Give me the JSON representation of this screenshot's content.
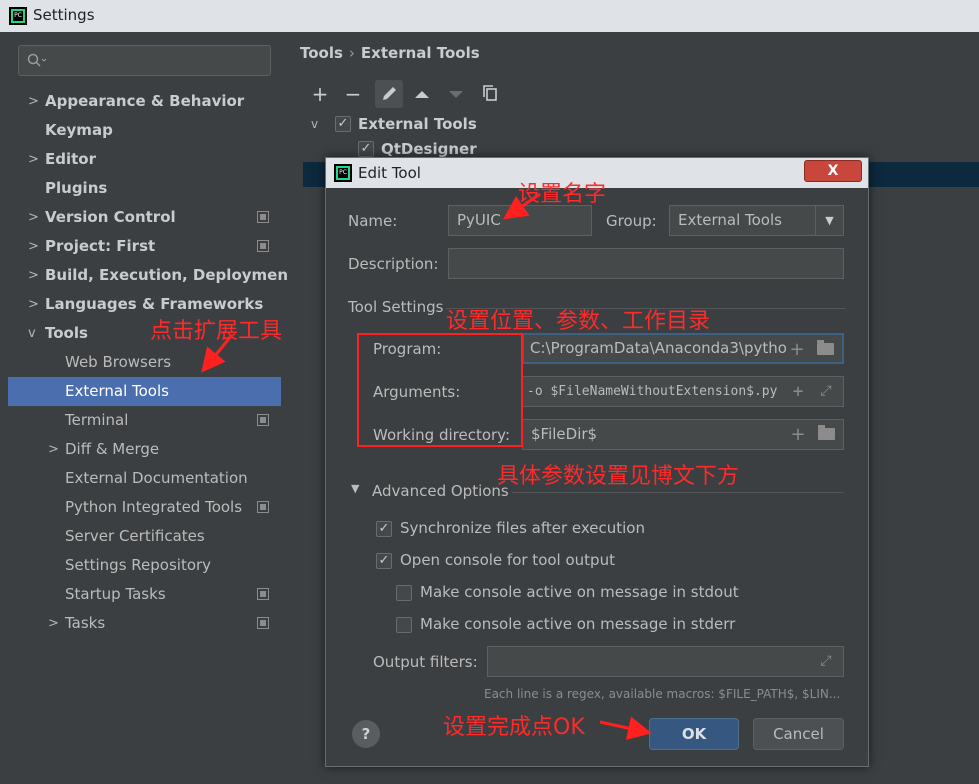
{
  "window": {
    "title": "Settings"
  },
  "sidebar": {
    "search_placeholder": "",
    "items": [
      {
        "label": "Appearance & Behavior",
        "arrow": ">"
      },
      {
        "label": "Keymap"
      },
      {
        "label": "Editor",
        "arrow": ">"
      },
      {
        "label": "Plugins"
      },
      {
        "label": "Version Control",
        "arrow": ">"
      },
      {
        "label": "Project: First",
        "arrow": ">"
      },
      {
        "label": "Build, Execution, Deployment",
        "arrow": ">"
      },
      {
        "label": "Languages & Frameworks",
        "arrow": ">"
      },
      {
        "label": "Tools",
        "arrow": "v"
      },
      {
        "label": "Web Browsers"
      },
      {
        "label": "External Tools"
      },
      {
        "label": "Terminal"
      },
      {
        "label": "Diff & Merge",
        "arrow": ">"
      },
      {
        "label": "External Documentation"
      },
      {
        "label": "Python Integrated Tools"
      },
      {
        "label": "Server Certificates"
      },
      {
        "label": "Settings Repository"
      },
      {
        "label": "Startup Tasks"
      },
      {
        "label": "Tasks",
        "arrow": ">"
      }
    ]
  },
  "main": {
    "breadcrumb": {
      "root": "Tools",
      "separator": "›",
      "current": "External Tools"
    },
    "toolbar": {
      "add": "+",
      "remove": "−"
    },
    "tree": {
      "group": "External Tools",
      "child": "QtDesigner"
    }
  },
  "dialog": {
    "title": "Edit Tool",
    "close": "X",
    "name_label": "Name:",
    "name_value": "PyUIC",
    "group_label": "Group:",
    "group_value": "External Tools",
    "description_label": "Description:",
    "description_value": "",
    "tool_settings_label": "Tool Settings",
    "program_label": "Program:",
    "program_value": "C:\\ProgramData\\Anaconda3\\pytho",
    "arguments_label": "Arguments:",
    "arguments_value": "-o $FileNameWithoutExtension$.py",
    "workdir_label": "Working directory:",
    "workdir_value": "$FileDir$",
    "advanced_label": "Advanced Options",
    "sync_label": "Synchronize files after execution",
    "open_console_label": "Open console for tool output",
    "stdout_label": "Make console active on message in stdout",
    "stderr_label": "Make console active on message in stderr",
    "output_filters_label": "Output filters:",
    "output_filters_value": "",
    "hint": "Each line is a regex, available macros: $FILE_PATH$, $LIN...",
    "help": "?",
    "ok": "OK",
    "cancel": "Cancel"
  },
  "annotations": {
    "set_name": "设置名字",
    "set_location": "设置位置、参数、工作目录",
    "click_expand": "点击扩展工具",
    "params_note": "具体参数设置见博文下方",
    "done_ok": "设置完成点OK",
    "color": "#ff2a2a"
  },
  "colors": {
    "selection": "#4b6eaf",
    "background": "#3c3f41",
    "ok_button": "#365880"
  }
}
